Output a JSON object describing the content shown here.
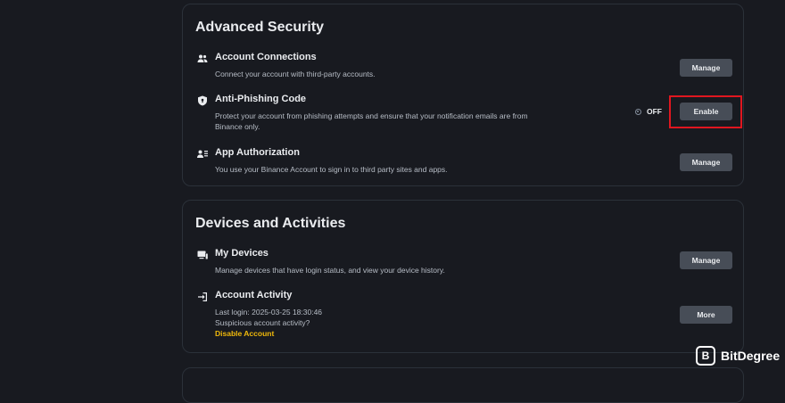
{
  "advanced_security": {
    "title": "Advanced Security",
    "items": [
      {
        "icon": "users-icon",
        "title": "Account Connections",
        "description": "Connect your account with third-party accounts.",
        "button": "Manage"
      },
      {
        "icon": "shield-icon",
        "title": "Anti-Phishing Code",
        "description": "Protect your account from phishing attempts and ensure that your notification emails are from Binance only.",
        "status": "OFF",
        "button": "Enable"
      },
      {
        "icon": "app-authorization-icon",
        "title": "App Authorization",
        "description": "You use your Binance Account to sign in to third party sites and apps.",
        "button": "Manage"
      }
    ]
  },
  "devices_activities": {
    "title": "Devices and Activities",
    "items": [
      {
        "icon": "devices-icon",
        "title": "My Devices",
        "description": "Manage devices that have login status, and view your device history.",
        "button": "Manage"
      },
      {
        "icon": "login-icon",
        "title": "Account Activity",
        "last_login": "Last login: 2025-03-25 18:30:46",
        "suspicious": "Suspicious account activity?",
        "link": "Disable Account",
        "button": "More"
      }
    ]
  },
  "watermark": {
    "text": "BitDegree"
  },
  "colors": {
    "background": "#181a20",
    "border": "#2b3139",
    "button": "#474d57",
    "warning_link": "#f0b90b",
    "highlight": "#e0161f"
  }
}
